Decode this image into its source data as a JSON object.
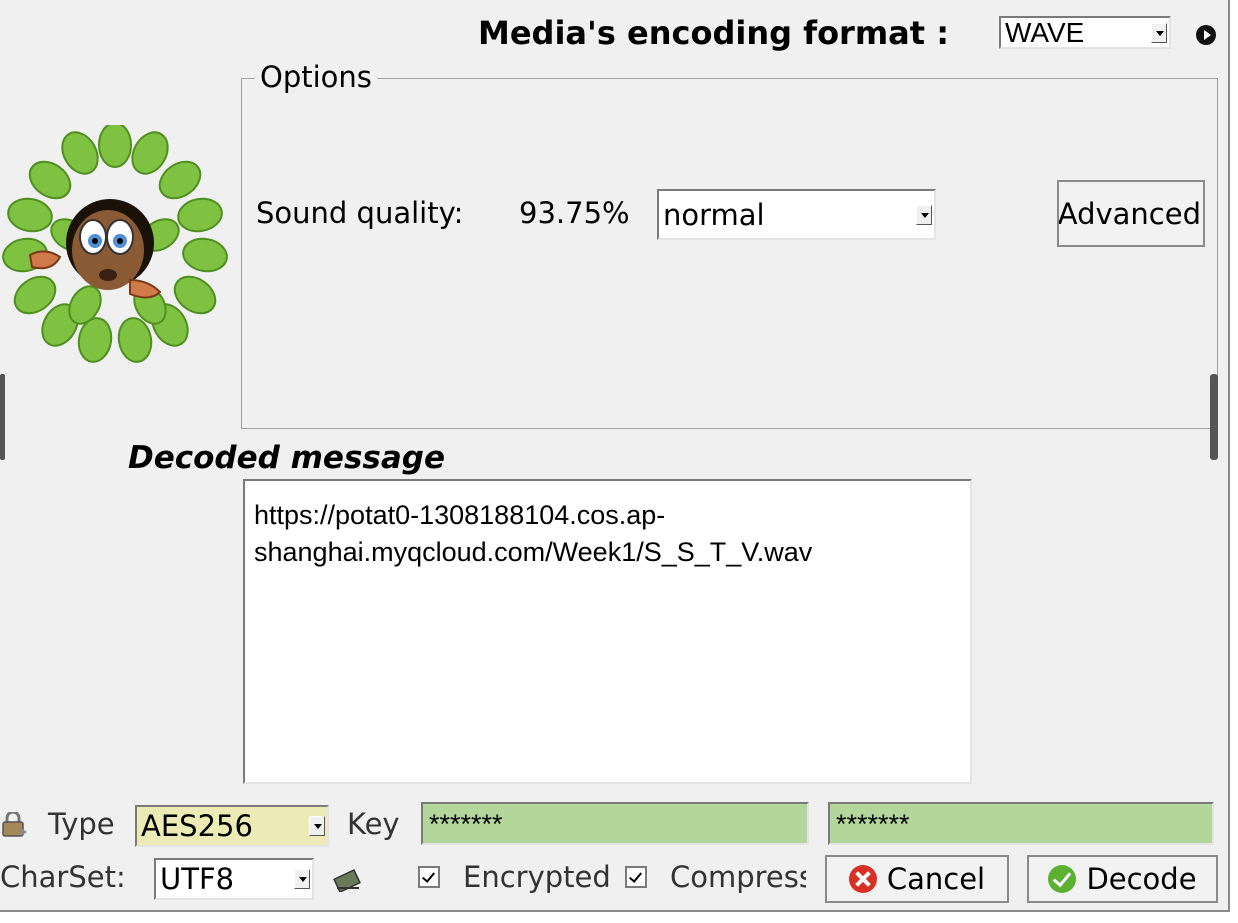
{
  "header": {
    "format_label": "Media's encoding format :",
    "format_value": "WAVE"
  },
  "options": {
    "legend": "Options",
    "sound_quality_label": "Sound quality:",
    "sound_quality_value": "93.75%",
    "quality_select": "normal",
    "advanced_label": "Advanced"
  },
  "message": {
    "heading": "Decoded message",
    "text": "https://potat0-1308188104.cos.ap-\nshanghai.myqcloud.com/Week1/S_S_T_V.wav"
  },
  "footer": {
    "type_label": "Type",
    "type_value": "AES256",
    "key_label": "Key",
    "key_value": "*******",
    "key_confirm_value": "*******",
    "charset_label": "CharSet:",
    "charset_value": "UTF8",
    "encrypted_label": "Encrypted",
    "compress_label": "Compress",
    "cancel_label": "Cancel",
    "decode_label": "Decode"
  },
  "colors": {
    "key_bg": "#b3d69a",
    "type_bg": "#ecebb5",
    "panel_bg": "#f0f0f0",
    "cancel_red": "#d93025",
    "decode_green": "#5cb032"
  }
}
